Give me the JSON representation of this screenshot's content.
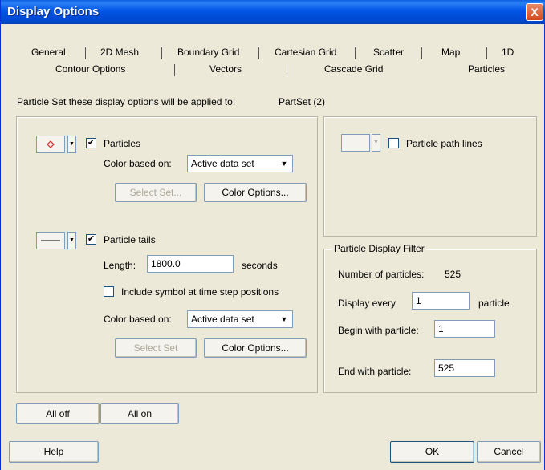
{
  "window": {
    "title": "Display Options",
    "close_glyph": "X"
  },
  "tabs_row1": [
    "General",
    "2D Mesh",
    "Boundary Grid",
    "Cartesian Grid",
    "Scatter",
    "Map",
    "1D"
  ],
  "tabs_row2": [
    "Contour Options",
    "Vectors",
    "Cascade Grid",
    "Particles"
  ],
  "particle_set": {
    "label": "Particle Set these display options will be applied to:",
    "value": "PartSet (2)"
  },
  "particles": {
    "label": "Particles",
    "checked": "✔",
    "color_based_label": "Color based on:",
    "color_based_value": "Active data set",
    "select_set": "Select Set...",
    "color_options": "Color Options..."
  },
  "tails": {
    "label": "Particle tails",
    "checked": "✔",
    "length_label": "Length:",
    "length_value": "1800.0",
    "length_unit": "seconds",
    "include_symbol": "Include symbol at time step positions",
    "color_based_label": "Color based on:",
    "color_based_value": "Active data set",
    "select_set": "Select Set",
    "color_options": "Color Options..."
  },
  "path_lines": {
    "label": "Particle path lines"
  },
  "filter": {
    "title": "Particle Display Filter",
    "num_label": "Number of particles:",
    "num_value": "525",
    "display_every_label": "Display every",
    "display_every_value": "1",
    "display_every_unit": "particle",
    "begin_label": "Begin with particle:",
    "begin_value": "1",
    "end_label": "End with particle:",
    "end_value": "525"
  },
  "buttons": {
    "all_off": "All off",
    "all_on": "All on",
    "help": "Help",
    "ok": "OK",
    "cancel": "Cancel"
  },
  "colors": {
    "title_bar": "#0055e5",
    "dialog_bg": "#ece9d8",
    "marker": "#d63a3a"
  }
}
